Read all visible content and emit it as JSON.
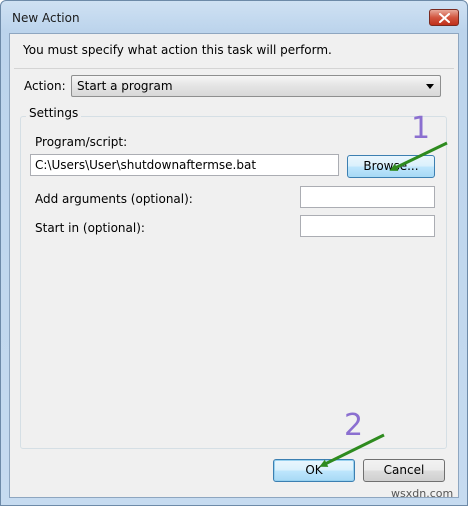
{
  "window": {
    "title": "New Action",
    "close_icon": "close-icon"
  },
  "instruction": "You must specify what action this task will perform.",
  "action": {
    "label": "Action:",
    "selected": "Start a program"
  },
  "settings": {
    "group_label": "Settings",
    "program_label": "Program/script:",
    "program_value": "C:\\Users\\User\\shutdownaftermse.bat",
    "browse_label": "Browse...",
    "arguments_label": "Add arguments (optional):",
    "arguments_value": "",
    "start_in_label": "Start in (optional):",
    "start_in_value": ""
  },
  "buttons": {
    "ok": "OK",
    "cancel": "Cancel"
  },
  "annotations": {
    "step1": "1",
    "step2": "2",
    "arrow_color": "#2e8b1f",
    "number_color": "#8b6fd0"
  },
  "watermark": "wsxdn.com"
}
